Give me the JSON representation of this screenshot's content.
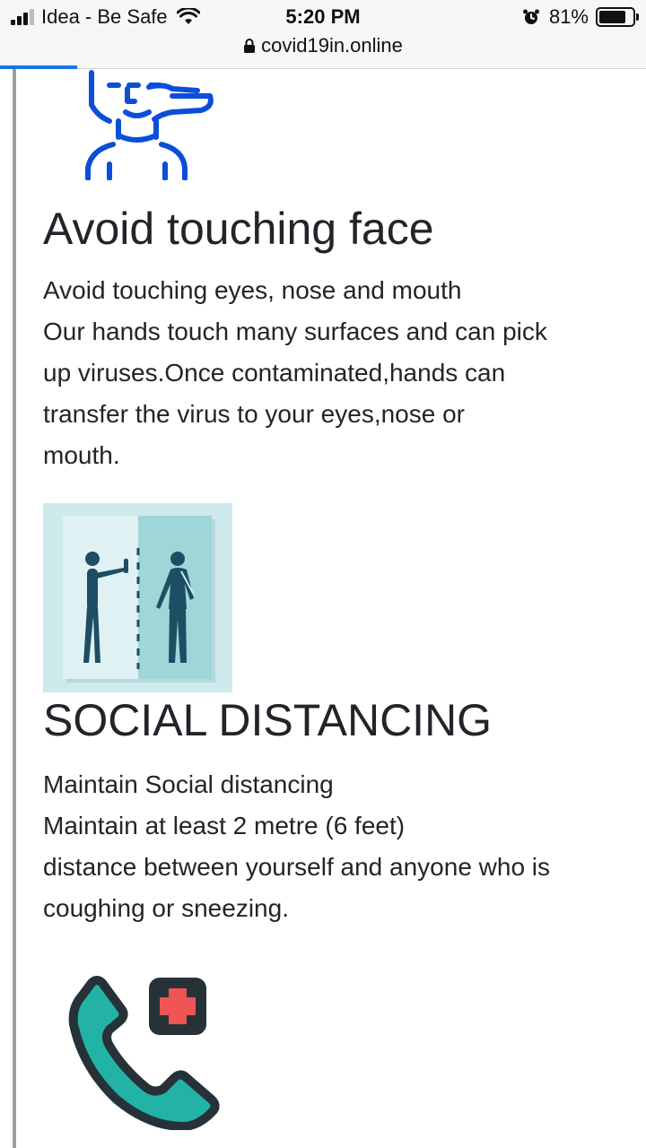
{
  "status_bar": {
    "carrier": "Idea - Be Safe",
    "time": "5:20 PM",
    "battery_percent": "81%",
    "battery_level": 0.81,
    "icons": [
      "signal-icon",
      "wifi-icon",
      "alarm-icon",
      "battery-icon"
    ]
  },
  "url_bar": {
    "url": "covid19in.online",
    "load_progress": 0.12,
    "progress_color": "#1a73e8"
  },
  "sections": [
    {
      "icon": "touch-face-icon",
      "title": "Avoid touching face",
      "lines": [
        "Avoid touching eyes, nose and mouth",
        "Our hands touch many surfaces and can pick",
        "up viruses.Once contaminated,hands can",
        "transfer the virus to your eyes,nose or",
        "mouth."
      ]
    },
    {
      "icon": "social-distancing-icon",
      "title": "SOCIAL DISTANCING",
      "lines": [
        "Maintain Social distancing",
        "Maintain at least 2 metre (6 feet)",
        "distance between yourself and anyone who is",
        "coughing or sneezing."
      ]
    },
    {
      "icon": "medical-call-icon"
    }
  ],
  "colors": {
    "icon_blue": "#0b4ed8",
    "teal_light": "#cfeaec",
    "teal": "#9fd6d8",
    "figure": "#1d4e63",
    "phone_teal": "#22b3a6",
    "cross_red": "#f05454",
    "dark_outline": "#263238"
  }
}
